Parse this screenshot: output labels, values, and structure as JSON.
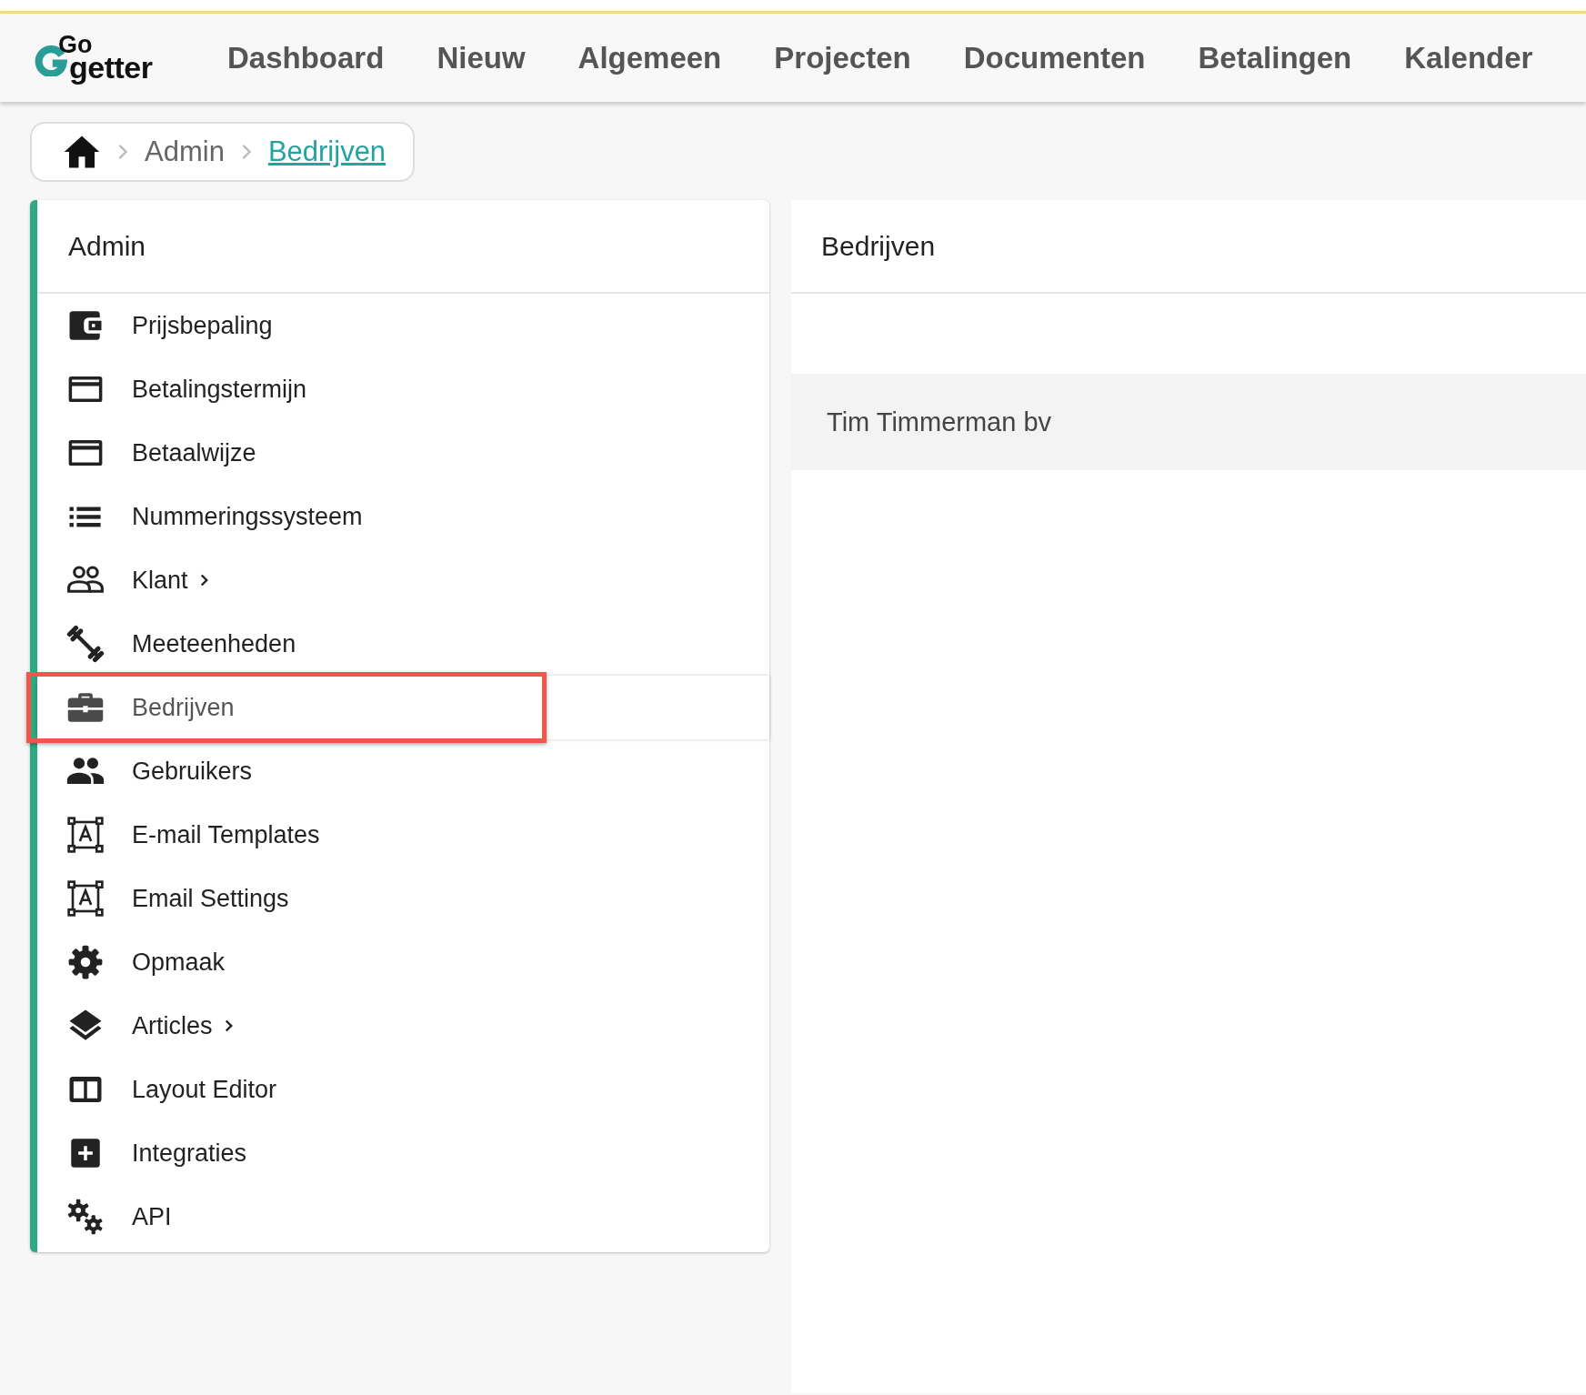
{
  "logo": {
    "top": "Go",
    "bottom": "getter"
  },
  "nav": [
    {
      "label": "Dashboard"
    },
    {
      "label": "Nieuw"
    },
    {
      "label": "Algemeen"
    },
    {
      "label": "Projecten"
    },
    {
      "label": "Documenten"
    },
    {
      "label": "Betalingen"
    },
    {
      "label": "Kalender"
    }
  ],
  "breadcrumb": [
    {
      "label": "Admin",
      "current": false
    },
    {
      "label": "Bedrijven",
      "current": true
    }
  ],
  "sidebar": {
    "title": "Admin",
    "items": [
      {
        "label": "Prijsbepaling",
        "kind": "wallet",
        "submenu": false,
        "selected": false
      },
      {
        "label": "Betalingstermijn",
        "kind": "card",
        "submenu": false,
        "selected": false
      },
      {
        "label": "Betaalwijze",
        "kind": "card",
        "submenu": false,
        "selected": false
      },
      {
        "label": "Nummeringssysteem",
        "kind": "list",
        "submenu": false,
        "selected": false
      },
      {
        "label": "Klant",
        "kind": "group",
        "submenu": true,
        "selected": false
      },
      {
        "label": "Meeteenheden",
        "kind": "dumbbell",
        "submenu": false,
        "selected": false
      },
      {
        "label": "Bedrijven",
        "kind": "briefcase",
        "submenu": false,
        "selected": true
      },
      {
        "label": "Gebruikers",
        "kind": "people",
        "submenu": false,
        "selected": false
      },
      {
        "label": "E-mail Templates",
        "kind": "template",
        "submenu": false,
        "selected": false
      },
      {
        "label": "Email Settings",
        "kind": "template",
        "submenu": false,
        "selected": false
      },
      {
        "label": "Opmaak",
        "kind": "gear",
        "submenu": false,
        "selected": false
      },
      {
        "label": "Articles",
        "kind": "layers",
        "submenu": true,
        "selected": false
      },
      {
        "label": "Layout Editor",
        "kind": "columns",
        "submenu": false,
        "selected": false
      },
      {
        "label": "Integraties",
        "kind": "plus",
        "submenu": false,
        "selected": false
      },
      {
        "label": "API",
        "kind": "gears",
        "submenu": false,
        "selected": false
      }
    ]
  },
  "panel": {
    "title": "Bedrijven",
    "rows": [
      "Tim Timmerman bv"
    ]
  }
}
